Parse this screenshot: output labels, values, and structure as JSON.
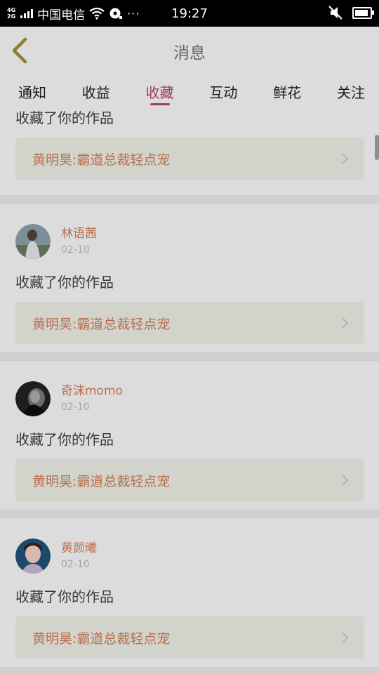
{
  "status_bar": {
    "net_top": "4G",
    "net_bottom": "2G",
    "carrier": "中国电信",
    "dots": "···",
    "time": "19:27"
  },
  "header": {
    "title": "消息"
  },
  "tabs": [
    {
      "label": "通知"
    },
    {
      "label": "收益"
    },
    {
      "label": "收藏"
    },
    {
      "label": "互动"
    },
    {
      "label": "鲜花"
    },
    {
      "label": "关注"
    }
  ],
  "active_tab": "收藏",
  "feed": {
    "partial_item": {
      "action": "收藏了你的作品",
      "work_title": "黄明昊:霸道总裁轻点宠"
    },
    "items": [
      {
        "user": "林语茜",
        "date": "02-10",
        "action": "收藏了你的作品",
        "work_title": "黄明昊:霸道总裁轻点宠"
      },
      {
        "user": "奇沫momo",
        "date": "02-10",
        "action": "收藏了你的作品",
        "work_title": "黄明昊:霸道总裁轻点宠"
      },
      {
        "user": "黄颜曦",
        "date": "02-10",
        "action": "收藏了你的作品",
        "work_title": "黄明昊:霸道总裁轻点宠"
      }
    ]
  },
  "colors": {
    "accent": "#a23b5f",
    "username": "#b96e4e",
    "background": "#dcdcdc"
  }
}
